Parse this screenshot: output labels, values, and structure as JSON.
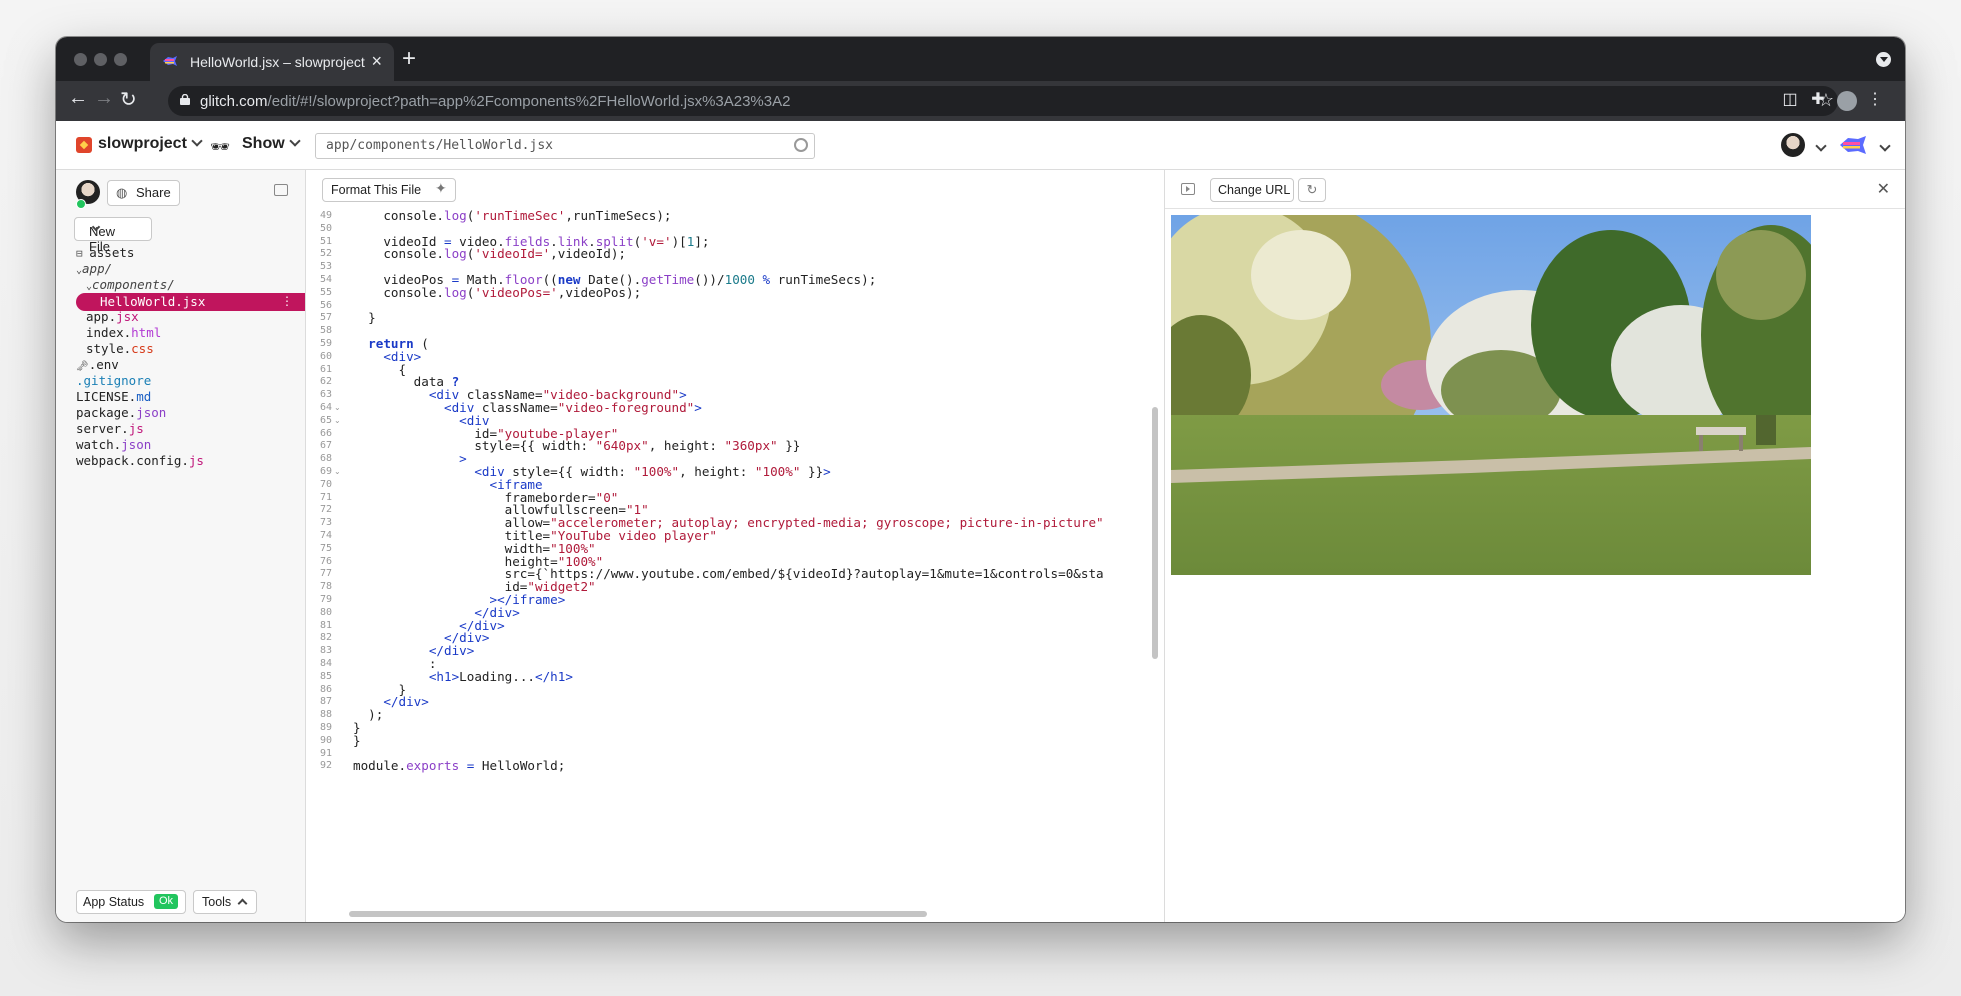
{
  "browser": {
    "tab_title": "HelloWorld.jsx – slowproject",
    "url_host": "glitch.com",
    "url_path": "/edit/#!/slowproject?path=app%2Fcomponents%2FHelloWorld.jsx%3A23%3A2"
  },
  "header": {
    "project_name": "slowproject",
    "show_label": "Show",
    "file_search_value": "app/components/HelloWorld.jsx"
  },
  "sidebar": {
    "share_label": "Share",
    "new_file_label": "New File",
    "files": [
      {
        "label": "assets",
        "ext": "",
        "kind": "assets"
      },
      {
        "label": "app/",
        "ext": "",
        "kind": "folder"
      },
      {
        "label": "components/",
        "ext": "",
        "kind": "folder"
      },
      {
        "label": "HelloWorld.jsx",
        "ext": "",
        "kind": "selected"
      },
      {
        "label": "app.",
        "ext": "jsx",
        "kind": "file"
      },
      {
        "label": "index.",
        "ext": "html",
        "kind": "file"
      },
      {
        "label": "style.",
        "ext": "css",
        "kind": "file"
      },
      {
        "label": ".env",
        "ext": "",
        "kind": "env"
      },
      {
        "label": ".gitignore",
        "ext": "",
        "kind": "git"
      },
      {
        "label": "LICENSE.",
        "ext": "md",
        "kind": "file"
      },
      {
        "label": "package.",
        "ext": "json",
        "kind": "file"
      },
      {
        "label": "server.",
        "ext": "js",
        "kind": "file"
      },
      {
        "label": "watch.",
        "ext": "json",
        "kind": "file"
      },
      {
        "label": "webpack.config.",
        "ext": "js",
        "kind": "file"
      }
    ],
    "app_status_label": "App Status",
    "app_status_value": "Ok",
    "tools_label": "Tools"
  },
  "editor": {
    "format_label": "Format This File",
    "lines": [
      {
        "n": "49",
        "html": "    console.<span class='fn'>log</span>(<span class='str'>'runTimeSec'</span>,runTimeSecs);"
      },
      {
        "n": "50",
        "html": ""
      },
      {
        "n": "51",
        "html": "    videoId <span class='tag'>=</span> video.<span class='fn'>fields</span>.<span class='fn'>link</span>.<span class='fn'>split</span>(<span class='str'>'v='</span>)[<span class='num'>1</span>];"
      },
      {
        "n": "52",
        "html": "    console.<span class='fn'>log</span>(<span class='str'>'videoId='</span>,videoId);"
      },
      {
        "n": "53",
        "html": ""
      },
      {
        "n": "54",
        "html": "    videoPos <span class='tag'>=</span> Math.<span class='fn'>floor</span>((<span class='kw'>new</span> Date().<span class='fn'>getTime</span>())/<span class='num'>1000</span> <span class='tag'>%</span> runTimeSecs);"
      },
      {
        "n": "55",
        "html": "    console.<span class='fn'>log</span>(<span class='str'>'videoPos='</span>,videoPos);"
      },
      {
        "n": "56",
        "html": ""
      },
      {
        "n": "57",
        "html": "  }"
      },
      {
        "n": "58",
        "html": ""
      },
      {
        "n": "59",
        "html": "  <span class='kw'>return</span> ("
      },
      {
        "n": "60",
        "html": "    <span class='tag'>&lt;div&gt;</span>"
      },
      {
        "n": "61",
        "html": "      {"
      },
      {
        "n": "62",
        "html": "        data <span class='kw'>?</span>"
      },
      {
        "n": "63",
        "html": "          <span class='tag'>&lt;div</span> className=<span class='str'>\"video-background\"</span><span class='tag'>&gt;</span>"
      },
      {
        "n": "64",
        "html": "            <span class='tag'>&lt;div</span> className=<span class='str'>\"video-foreground\"</span><span class='tag'>&gt;</span>",
        "fold": true
      },
      {
        "n": "65",
        "html": "              <span class='tag'>&lt;div</span>",
        "fold": true
      },
      {
        "n": "66",
        "html": "                id=<span class='str'>\"youtube-player\"</span>"
      },
      {
        "n": "67",
        "html": "                style={{ width: <span class='str'>\"640px\"</span>, height: <span class='str'>\"360px\"</span> }}"
      },
      {
        "n": "68",
        "html": "              <span class='tag'>&gt;</span>"
      },
      {
        "n": "69",
        "html": "                <span class='tag'>&lt;div</span> style={{ width: <span class='str'>\"100%\"</span>, height: <span class='str'>\"100%\"</span> }}<span class='tag'>&gt;</span>",
        "fold": true
      },
      {
        "n": "70",
        "html": "                  <span class='tag'>&lt;iframe</span>"
      },
      {
        "n": "71",
        "html": "                    frameborder=<span class='str'>\"0\"</span>"
      },
      {
        "n": "72",
        "html": "                    allowfullscreen=<span class='str'>\"1\"</span>"
      },
      {
        "n": "73",
        "html": "                    allow=<span class='str'>\"accelerometer; autoplay; encrypted-media; gyroscope; picture-in-picture\"</span>"
      },
      {
        "n": "74",
        "html": "                    title=<span class='str'>\"YouTube video player\"</span>"
      },
      {
        "n": "75",
        "html": "                    width=<span class='str'>\"100%\"</span>"
      },
      {
        "n": "76",
        "html": "                    height=<span class='str'>\"100%\"</span>"
      },
      {
        "n": "77",
        "html": "                    src={`https://www.youtube.com/embed/${videoId}?autoplay=1&amp;mute=1&amp;controls=0&amp;sta"
      },
      {
        "n": "78",
        "html": "                    id=<span class='str'>\"widget2\"</span>"
      },
      {
        "n": "79",
        "html": "                  <span class='tag'>&gt;&lt;/iframe&gt;</span>"
      },
      {
        "n": "80",
        "html": "                <span class='tag'>&lt;/div&gt;</span>"
      },
      {
        "n": "81",
        "html": "              <span class='tag'>&lt;/div&gt;</span>"
      },
      {
        "n": "82",
        "html": "            <span class='tag'>&lt;/div&gt;</span>"
      },
      {
        "n": "83",
        "html": "          <span class='tag'>&lt;/div&gt;</span>"
      },
      {
        "n": "84",
        "html": "          :"
      },
      {
        "n": "85",
        "html": "          <span class='tag'>&lt;h1&gt;</span>Loading...<span class='tag'>&lt;/h1&gt;</span>"
      },
      {
        "n": "86",
        "html": "      }"
      },
      {
        "n": "87",
        "html": "    <span class='tag'>&lt;/div&gt;</span>"
      },
      {
        "n": "88",
        "html": "  );"
      },
      {
        "n": "89",
        "html": "}"
      },
      {
        "n": "90",
        "html": "}"
      },
      {
        "n": "91",
        "html": ""
      },
      {
        "n": "92",
        "html": "module.<span class='fn'>exports</span> <span class='tag'>=</span> HelloWorld;"
      }
    ]
  },
  "preview": {
    "change_url_label": "Change URL"
  },
  "colors": {
    "accent": "#c0155d",
    "ok_green": "#22c55e",
    "keyword_blue": "#1a3ac7",
    "string_red": "#b01a3a"
  }
}
